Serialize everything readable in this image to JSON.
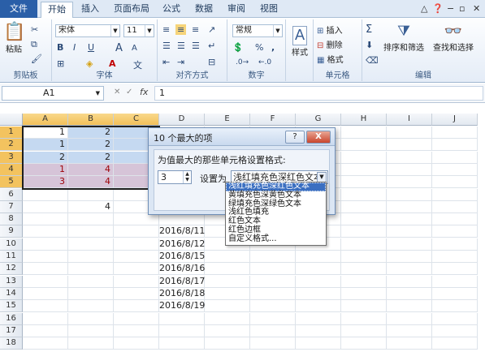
{
  "tabs": [
    "文件",
    "开始",
    "插入",
    "页面布局",
    "公式",
    "数据",
    "审阅",
    "视图"
  ],
  "active_tab": "开始",
  "window_controls": [
    "help-icon",
    "minimize-icon",
    "restore-icon",
    "close-icon"
  ],
  "ribbon": {
    "clipboard": {
      "paste": "粘贴",
      "label": "剪贴板"
    },
    "font": {
      "name": "宋体",
      "size": "11",
      "bold": "B",
      "italic": "I",
      "underline": "U",
      "grow": "A",
      "shrink": "A",
      "label": "字体"
    },
    "alignment": {
      "label": "对齐方式"
    },
    "number": {
      "format": "常规",
      "label": "数字",
      "percent": "%",
      "comma": ","
    },
    "styles": {
      "label": "样式"
    },
    "cells": {
      "insert": "插入",
      "delete": "删除",
      "format": "格式",
      "label": "单元格"
    },
    "editing": {
      "sort": "排序和筛选",
      "find": "查找和选择",
      "sum": "Σ",
      "label": "编辑"
    }
  },
  "formula_bar": {
    "name_box": "A1",
    "fx": "fx",
    "value": "1"
  },
  "columns": [
    "A",
    "B",
    "C",
    "D",
    "E",
    "F",
    "G",
    "H",
    "I",
    "J"
  ],
  "rows": [
    "1",
    "2",
    "3",
    "4",
    "5",
    "6",
    "7",
    "8",
    "9",
    "10",
    "11",
    "12",
    "13",
    "14",
    "15",
    "16",
    "17",
    "18"
  ],
  "cells": {
    "A1": "1",
    "B1": "2",
    "A2": "1",
    "B2": "2",
    "A3": "2",
    "B3": "2",
    "A4": "1",
    "B4": "4",
    "A5": "3",
    "B5": "4",
    "B7": "4",
    "D9": "2016/8/11",
    "D10": "2016/8/12",
    "D11": "2016/8/15",
    "D12": "2016/8/16",
    "D13": "2016/8/17",
    "D14": "2016/8/18",
    "D15": "2016/8/19"
  },
  "dialog": {
    "title": "10 个最大的项",
    "help": "?",
    "close": "X",
    "prompt": "为值最大的那些单元格设置格式:",
    "count": "3",
    "set_as_label": "设置为",
    "selected_format": "浅红填充色深红色文本"
  },
  "format_options": [
    "浅红填充色深红色文本",
    "黄填充色深黄色文本",
    "绿填充色深绿色文本",
    "浅红色填充",
    "红色文本",
    "红色边框",
    "自定义格式..."
  ],
  "colors": {
    "file_tab": "#2a5fa8",
    "selection": "#c5d9f1",
    "highlight_fill": "#d6c4d8",
    "highlight_text": "#9c0006",
    "list_highlight": "#3b6fc1"
  }
}
